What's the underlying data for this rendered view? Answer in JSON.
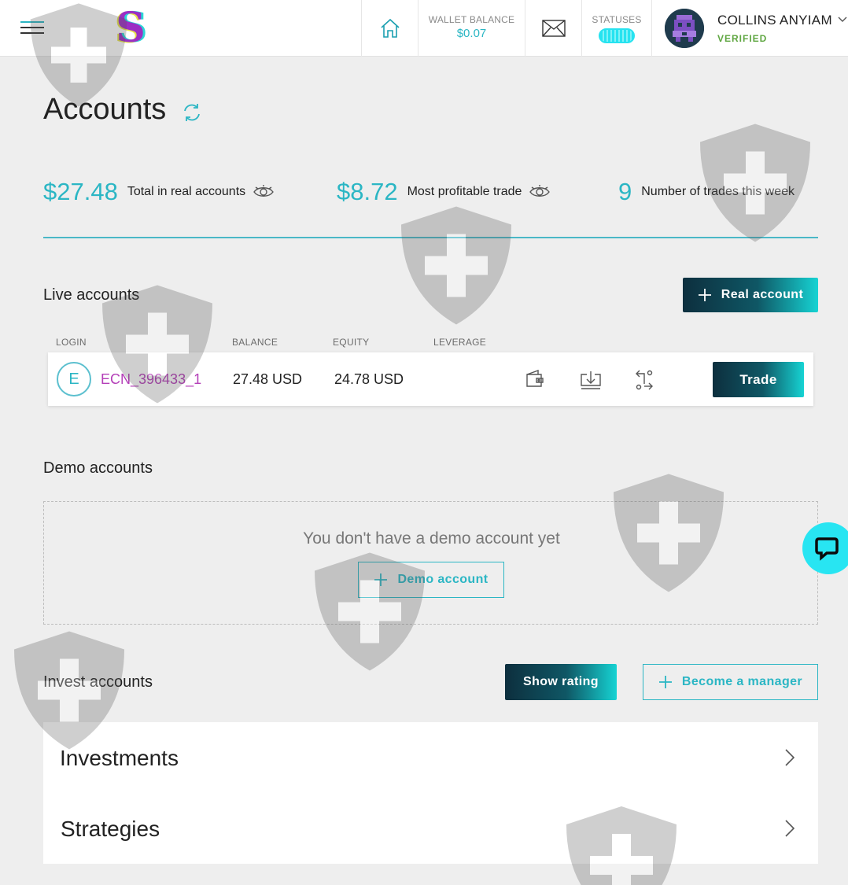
{
  "header": {
    "wallet_label": "WALLET BALANCE",
    "wallet_value": "$0.07",
    "statuses_label": "STATUSES",
    "user_name": "COLLINS ANYIAM",
    "user_status": "VERIFIED"
  },
  "page": {
    "title": "Accounts"
  },
  "stats": [
    {
      "value": "$27.48",
      "label": "Total in real accounts"
    },
    {
      "value": "$8.72",
      "label": "Most profitable trade"
    },
    {
      "value": "9",
      "label": "Number of trades this week"
    }
  ],
  "live": {
    "title": "Live accounts",
    "button": "Real account",
    "columns": [
      "LOGIN",
      "BALANCE",
      "EQUITY",
      "LEVERAGE"
    ],
    "row": {
      "badge": "E",
      "login": "ECN_396433_1",
      "balance": "27.48 USD",
      "equity": "24.78 USD",
      "trade": "Trade"
    }
  },
  "demo": {
    "title": "Demo accounts",
    "empty_text": "You don't have a demo account yet",
    "button": "Demo account"
  },
  "invest": {
    "title": "Invest accounts",
    "show_rating": "Show rating",
    "become_manager": "Become a manager",
    "cards": [
      "Investments",
      "Strategies"
    ]
  },
  "colors": {
    "accent": "#2bb6c4",
    "login_purple": "#b43fb8",
    "verified": "#5fa641"
  },
  "icons": [
    "menu-icon",
    "home-icon",
    "mail-icon",
    "refresh-icon",
    "eye-icon",
    "wallet-icon",
    "download-icon",
    "transfer-icon",
    "plus-icon",
    "chat-icon",
    "chevron-right-icon",
    "chevron-down-icon"
  ]
}
